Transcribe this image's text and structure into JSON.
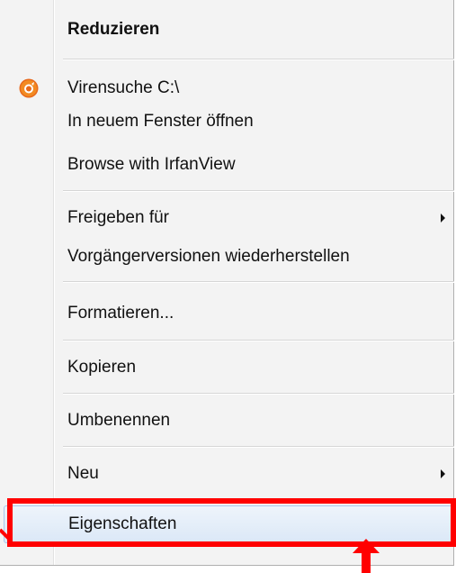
{
  "menu": {
    "items": [
      {
        "label": "Reduzieren",
        "bold": true
      },
      {
        "label": "Virensuche C:\\",
        "icon": "avast-icon"
      },
      {
        "label": "In neuem Fenster öffnen"
      },
      {
        "label": "Browse with IrfanView"
      },
      {
        "label": "Freigeben für",
        "submenu": true
      },
      {
        "label": "Vorgängerversionen wiederherstellen"
      },
      {
        "label": "Formatieren..."
      },
      {
        "label": "Kopieren"
      },
      {
        "label": "Umbenennen"
      },
      {
        "label": "Neu",
        "submenu": true
      },
      {
        "label": "Eigenschaften",
        "highlighted": true
      }
    ]
  },
  "annotation": {
    "highlight_color": "#ff0000",
    "icon": "up-arrow-icon"
  },
  "colors": {
    "menu_background": "#f3f3f3",
    "hover_background": "#dbe8f7",
    "hover_border": "#a9c7eb",
    "annotation_red": "#ff0000",
    "app_icon_orange": "#f07a1a"
  }
}
